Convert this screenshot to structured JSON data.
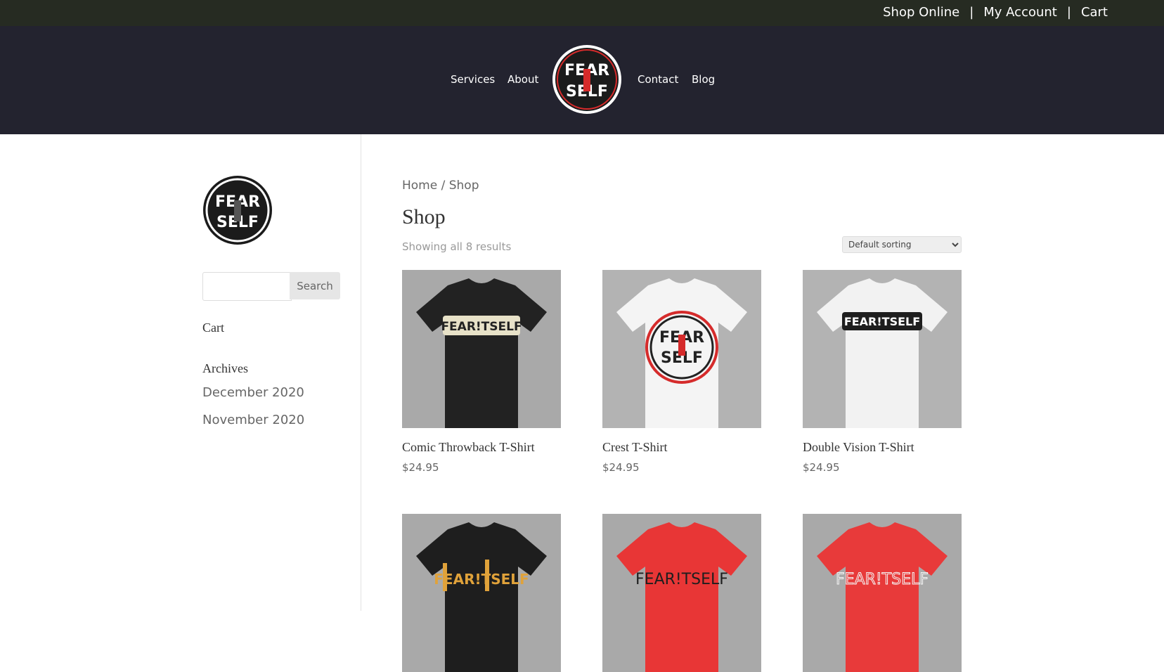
{
  "topbar": {
    "links": [
      "Shop Online",
      "My Account",
      "Cart"
    ],
    "separator": "|"
  },
  "nav": {
    "items": [
      "Services",
      "About",
      "Contact",
      "Blog"
    ],
    "logo_text": [
      "FEAR",
      "!T",
      "SELF"
    ]
  },
  "sidebar": {
    "search_placeholder": "",
    "search_button": "Search",
    "cart_title": "Cart",
    "archives_title": "Archives",
    "archives": [
      "December 2020",
      "November 2020"
    ]
  },
  "main": {
    "breadcrumb_home": "Home",
    "breadcrumb_sep": " / Shop",
    "title": "Shop",
    "results": "Showing all 8 results",
    "sort_selected": "Default sorting",
    "products": [
      {
        "name": "Comic Throwback T-Shirt",
        "price": "$24.95",
        "shirt": "#222222",
        "print": "FEAR!TSELF"
      },
      {
        "name": "Crest T-Shirt",
        "price": "$24.95",
        "shirt": "#f4f4f4",
        "print": "FEAR SELF"
      },
      {
        "name": "Double Vision T-Shirt",
        "price": "$24.95",
        "shirt": "#f2f2f2",
        "print": "FEAR!TSELF"
      },
      {
        "name": "",
        "price": "",
        "shirt": "#1e1e1e",
        "print": "FEAR!TSELF"
      },
      {
        "name": "",
        "price": "",
        "shirt": "#e83636",
        "print": "FEAR!TSELF"
      },
      {
        "name": "",
        "price": "",
        "shirt": "#e83a3a",
        "print": "FEAR!TSELF"
      }
    ]
  },
  "colors": {
    "topbar": "#262b22",
    "header": "#23232f",
    "accent_red": "#d52b2b"
  }
}
